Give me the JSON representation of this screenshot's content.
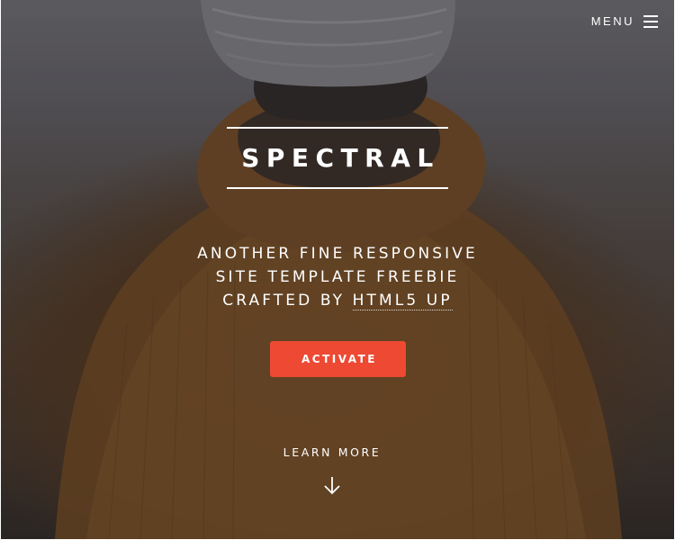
{
  "header": {
    "menu_label": "Menu",
    "menu_icon": "hamburger-icon"
  },
  "hero": {
    "title": "Spectral",
    "tagline_lines": [
      "Another fine responsive",
      "site template freebie",
      "crafted by"
    ],
    "credit_link": "HTML5 UP",
    "cta_label": "Activate",
    "learn_more_label": "Learn More",
    "learn_more_icon": "arrow-down-icon"
  },
  "colors": {
    "accent": "#ed4933",
    "text": "#ffffff"
  }
}
